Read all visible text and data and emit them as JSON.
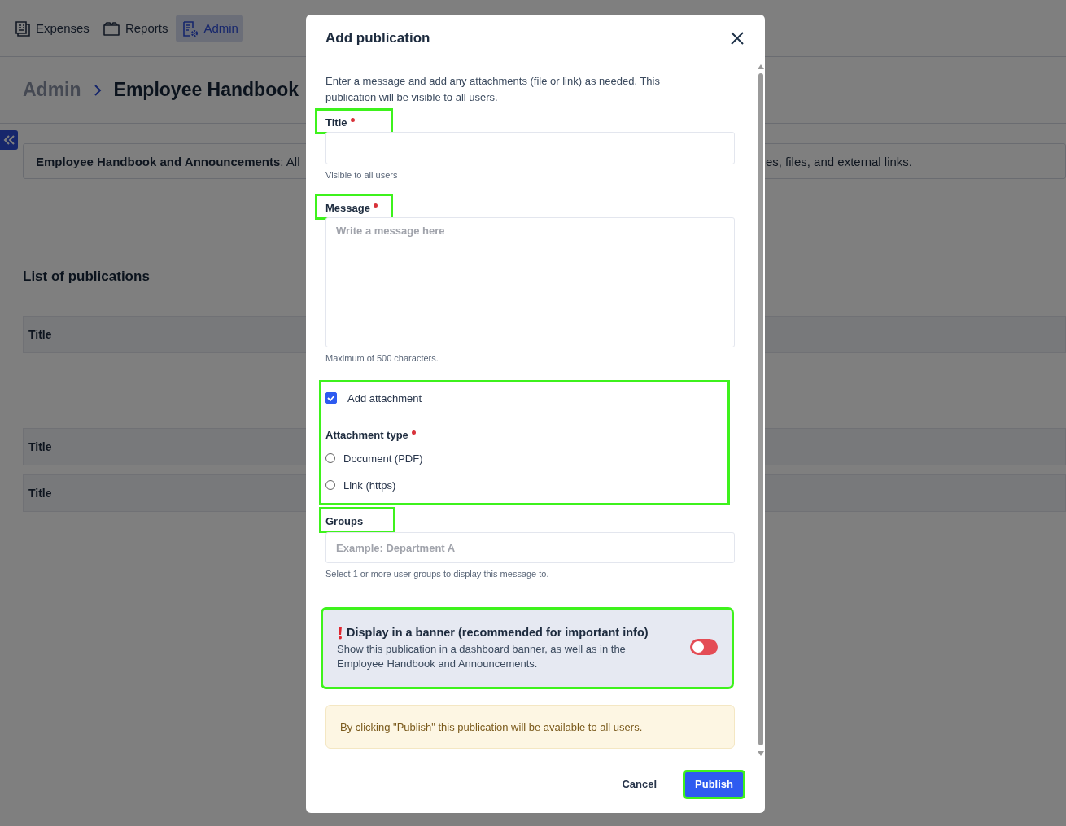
{
  "nav": {
    "tabs": [
      {
        "label": "Expenses",
        "selected": false
      },
      {
        "label": "Reports",
        "selected": false
      },
      {
        "label": "Admin",
        "selected": true
      }
    ]
  },
  "breadcrumb": {
    "parent": "Admin",
    "current": "Employee Handbook"
  },
  "info": {
    "left": "**Employee Handbook and Announcements**: All",
    "right": "es, files, and external links."
  },
  "list": {
    "heading": "List of publications",
    "rows": [
      {
        "title": "Title"
      },
      {
        "title": "Title"
      },
      {
        "title": "Title"
      }
    ]
  },
  "dialog": {
    "title": "Add publication",
    "intro": "Enter a message and add any attachments (file or link) as needed. This publication will be visible to all users.",
    "title_field": {
      "label": "Title",
      "required": true,
      "highlighted": true,
      "hint": "Visible to all users"
    },
    "message_field": {
      "label": "Message",
      "required": true,
      "highlighted": true,
      "placeholder": "Write a message here",
      "hint": "Maximum of 500 characters."
    },
    "attachment": {
      "highlighted": true,
      "checkbox": {
        "label": "Add attachment",
        "checked": true
      },
      "type_label": "Attachment type",
      "required": true,
      "options": [
        {
          "label": "Document (PDF)",
          "selected": false
        },
        {
          "label": "Link (https)",
          "selected": false
        }
      ]
    },
    "groups_field": {
      "label": "Groups",
      "highlighted": true,
      "placeholder": "Example: Department A",
      "hint": "Select 1 or more user groups to display this message to."
    },
    "banner": {
      "highlighted": true,
      "title": "Display in a banner (recommended for important info)",
      "description": "Show this publication in a dashboard banner, as well as in the Employee Handbook and Announcements.",
      "on": false
    },
    "notice": "By clicking \"Publish\" this publication will be available to all users.",
    "buttons": [
      {
        "label": "Cancel",
        "kind": "secondary",
        "highlighted": false
      },
      {
        "label": "Publish",
        "kind": "primary",
        "highlighted": true
      }
    ]
  }
}
